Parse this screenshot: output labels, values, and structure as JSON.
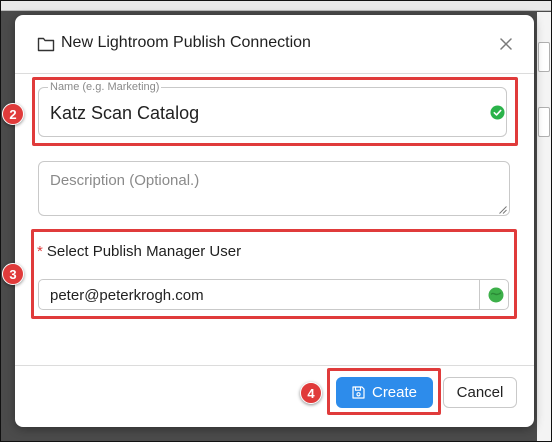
{
  "dialog": {
    "title": "New Lightroom Publish Connection",
    "title_icon": "folder-icon",
    "close_icon": "close-icon"
  },
  "form": {
    "name": {
      "label": "Name (e.g. Marketing)",
      "value": "Katz Scan Catalog",
      "status_icon": "check-circle-icon",
      "status_color": "#2bb34a"
    },
    "description": {
      "placeholder": "Description (Optional.)",
      "value": ""
    },
    "publish_manager": {
      "required_marker": "*",
      "label": "Select Publish Manager User",
      "value": "peter@peterkrogh.com",
      "status_icon": "status-dot-icon",
      "status_color": "#3db04a"
    }
  },
  "footer": {
    "create_label": "Create",
    "create_icon": "save-icon",
    "cancel_label": "Cancel"
  },
  "annotations": {
    "badges": [
      "2",
      "3",
      "4"
    ],
    "color": "#e03b3b"
  },
  "colors": {
    "primary": "#2d8ceb",
    "highlight": "#e03b3b",
    "backdrop": "#4b4b4b"
  }
}
